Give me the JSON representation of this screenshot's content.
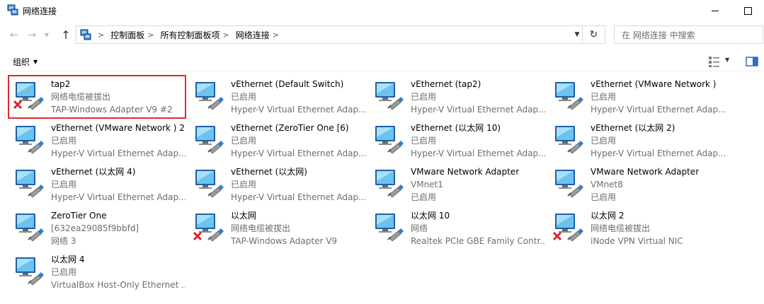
{
  "window": {
    "title": "网络连接"
  },
  "address": {
    "crumbs": [
      "控制面板",
      "所有控制面板项",
      "网络连接"
    ],
    "search_placeholder": "在 网络连接 中搜索"
  },
  "toolbar": {
    "organize_label": "组织"
  },
  "colors": {
    "selection_border": "#e0282f",
    "secondary_text": "#6d6d6d",
    "disconnected_x": "#d9232e"
  },
  "connections": [
    {
      "name": "tap2",
      "status": "网络电缆被拔出",
      "device": "TAP-Windows Adapter V9 #2",
      "disconnected": true,
      "selected": true
    },
    {
      "name": "vEthernet (Default Switch)",
      "status": "已启用",
      "device": "Hyper-V Virtual Ethernet Adap...",
      "disconnected": false
    },
    {
      "name": "vEthernet (tap2)",
      "status": "已启用",
      "device": "Hyper-V Virtual Ethernet Adap...",
      "disconnected": false
    },
    {
      "name": "vEthernet (VMware Network )",
      "status": "已启用",
      "device": "Hyper-V Virtual Ethernet Adap...",
      "disconnected": false
    },
    {
      "name": "vEthernet (VMware Network ) 2",
      "status": "已启用",
      "device": "Hyper-V Virtual Ethernet Adap...",
      "disconnected": false
    },
    {
      "name": "vEthernet (ZeroTier One [6)",
      "status": "已启用",
      "device": "Hyper-V Virtual Ethernet Adap...",
      "disconnected": false
    },
    {
      "name": "vEthernet (以太网 10)",
      "status": "已启用",
      "device": "Hyper-V Virtual Ethernet Adap...",
      "disconnected": false
    },
    {
      "name": "vEthernet (以太网 2)",
      "status": "已启用",
      "device": "Hyper-V Virtual Ethernet Adap...",
      "disconnected": false
    },
    {
      "name": "vEthernet (以太网 4)",
      "status": "已启用",
      "device": "Hyper-V Virtual Ethernet Adap...",
      "disconnected": false
    },
    {
      "name": "vEthernet (以太网)",
      "status": "已启用",
      "device": "Hyper-V Virtual Ethernet Adap...",
      "disconnected": false
    },
    {
      "name": "VMware Network Adapter",
      "status": "VMnet1",
      "device": "已启用",
      "disconnected": false
    },
    {
      "name": "VMware Network Adapter",
      "status": "VMnet8",
      "device": "已启用",
      "disconnected": false
    },
    {
      "name": "ZeroTier One",
      "status": "[632ea29085f9bbfd]",
      "device": "网络 3",
      "disconnected": false
    },
    {
      "name": "以太网",
      "status": "网络电缆被拔出",
      "device": "TAP-Windows Adapter V9",
      "disconnected": true
    },
    {
      "name": "以太网 10",
      "status": "网络",
      "device": "Realtek PCIe GBE Family Contr...",
      "disconnected": false
    },
    {
      "name": "以太网 2",
      "status": "网络电缆被拔出",
      "device": "iNode VPN Virtual NIC",
      "disconnected": true
    },
    {
      "name": "以太网 4",
      "status": "已启用",
      "device": "VirtualBox Host-Only Ethernet ...",
      "disconnected": false
    }
  ]
}
